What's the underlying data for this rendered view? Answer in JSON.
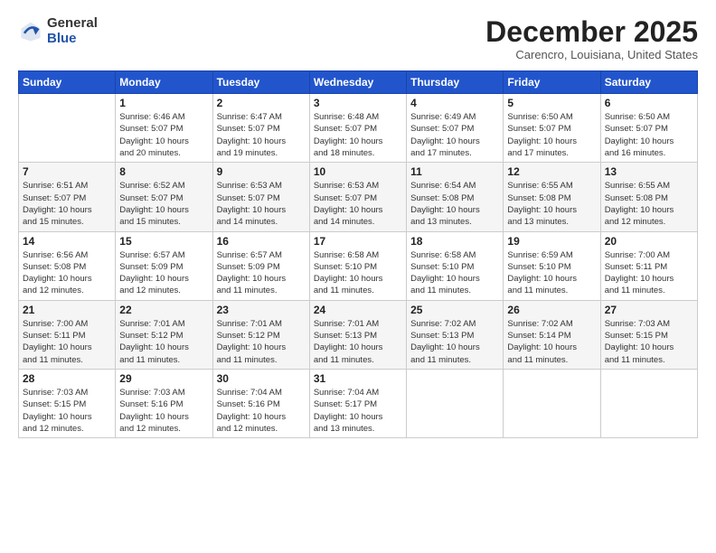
{
  "logo": {
    "general": "General",
    "blue": "Blue"
  },
  "header": {
    "month": "December 2025",
    "location": "Carencro, Louisiana, United States"
  },
  "weekdays": [
    "Sunday",
    "Monday",
    "Tuesday",
    "Wednesday",
    "Thursday",
    "Friday",
    "Saturday"
  ],
  "weeks": [
    [
      {
        "day": "",
        "info": ""
      },
      {
        "day": "1",
        "info": "Sunrise: 6:46 AM\nSunset: 5:07 PM\nDaylight: 10 hours\nand 20 minutes."
      },
      {
        "day": "2",
        "info": "Sunrise: 6:47 AM\nSunset: 5:07 PM\nDaylight: 10 hours\nand 19 minutes."
      },
      {
        "day": "3",
        "info": "Sunrise: 6:48 AM\nSunset: 5:07 PM\nDaylight: 10 hours\nand 18 minutes."
      },
      {
        "day": "4",
        "info": "Sunrise: 6:49 AM\nSunset: 5:07 PM\nDaylight: 10 hours\nand 17 minutes."
      },
      {
        "day": "5",
        "info": "Sunrise: 6:50 AM\nSunset: 5:07 PM\nDaylight: 10 hours\nand 17 minutes."
      },
      {
        "day": "6",
        "info": "Sunrise: 6:50 AM\nSunset: 5:07 PM\nDaylight: 10 hours\nand 16 minutes."
      }
    ],
    [
      {
        "day": "7",
        "info": "Sunrise: 6:51 AM\nSunset: 5:07 PM\nDaylight: 10 hours\nand 15 minutes."
      },
      {
        "day": "8",
        "info": "Sunrise: 6:52 AM\nSunset: 5:07 PM\nDaylight: 10 hours\nand 15 minutes."
      },
      {
        "day": "9",
        "info": "Sunrise: 6:53 AM\nSunset: 5:07 PM\nDaylight: 10 hours\nand 14 minutes."
      },
      {
        "day": "10",
        "info": "Sunrise: 6:53 AM\nSunset: 5:07 PM\nDaylight: 10 hours\nand 14 minutes."
      },
      {
        "day": "11",
        "info": "Sunrise: 6:54 AM\nSunset: 5:08 PM\nDaylight: 10 hours\nand 13 minutes."
      },
      {
        "day": "12",
        "info": "Sunrise: 6:55 AM\nSunset: 5:08 PM\nDaylight: 10 hours\nand 13 minutes."
      },
      {
        "day": "13",
        "info": "Sunrise: 6:55 AM\nSunset: 5:08 PM\nDaylight: 10 hours\nand 12 minutes."
      }
    ],
    [
      {
        "day": "14",
        "info": "Sunrise: 6:56 AM\nSunset: 5:08 PM\nDaylight: 10 hours\nand 12 minutes."
      },
      {
        "day": "15",
        "info": "Sunrise: 6:57 AM\nSunset: 5:09 PM\nDaylight: 10 hours\nand 12 minutes."
      },
      {
        "day": "16",
        "info": "Sunrise: 6:57 AM\nSunset: 5:09 PM\nDaylight: 10 hours\nand 11 minutes."
      },
      {
        "day": "17",
        "info": "Sunrise: 6:58 AM\nSunset: 5:10 PM\nDaylight: 10 hours\nand 11 minutes."
      },
      {
        "day": "18",
        "info": "Sunrise: 6:58 AM\nSunset: 5:10 PM\nDaylight: 10 hours\nand 11 minutes."
      },
      {
        "day": "19",
        "info": "Sunrise: 6:59 AM\nSunset: 5:10 PM\nDaylight: 10 hours\nand 11 minutes."
      },
      {
        "day": "20",
        "info": "Sunrise: 7:00 AM\nSunset: 5:11 PM\nDaylight: 10 hours\nand 11 minutes."
      }
    ],
    [
      {
        "day": "21",
        "info": "Sunrise: 7:00 AM\nSunset: 5:11 PM\nDaylight: 10 hours\nand 11 minutes."
      },
      {
        "day": "22",
        "info": "Sunrise: 7:01 AM\nSunset: 5:12 PM\nDaylight: 10 hours\nand 11 minutes."
      },
      {
        "day": "23",
        "info": "Sunrise: 7:01 AM\nSunset: 5:12 PM\nDaylight: 10 hours\nand 11 minutes."
      },
      {
        "day": "24",
        "info": "Sunrise: 7:01 AM\nSunset: 5:13 PM\nDaylight: 10 hours\nand 11 minutes."
      },
      {
        "day": "25",
        "info": "Sunrise: 7:02 AM\nSunset: 5:13 PM\nDaylight: 10 hours\nand 11 minutes."
      },
      {
        "day": "26",
        "info": "Sunrise: 7:02 AM\nSunset: 5:14 PM\nDaylight: 10 hours\nand 11 minutes."
      },
      {
        "day": "27",
        "info": "Sunrise: 7:03 AM\nSunset: 5:15 PM\nDaylight: 10 hours\nand 11 minutes."
      }
    ],
    [
      {
        "day": "28",
        "info": "Sunrise: 7:03 AM\nSunset: 5:15 PM\nDaylight: 10 hours\nand 12 minutes."
      },
      {
        "day": "29",
        "info": "Sunrise: 7:03 AM\nSunset: 5:16 PM\nDaylight: 10 hours\nand 12 minutes."
      },
      {
        "day": "30",
        "info": "Sunrise: 7:04 AM\nSunset: 5:16 PM\nDaylight: 10 hours\nand 12 minutes."
      },
      {
        "day": "31",
        "info": "Sunrise: 7:04 AM\nSunset: 5:17 PM\nDaylight: 10 hours\nand 13 minutes."
      },
      {
        "day": "",
        "info": ""
      },
      {
        "day": "",
        "info": ""
      },
      {
        "day": "",
        "info": ""
      }
    ]
  ]
}
